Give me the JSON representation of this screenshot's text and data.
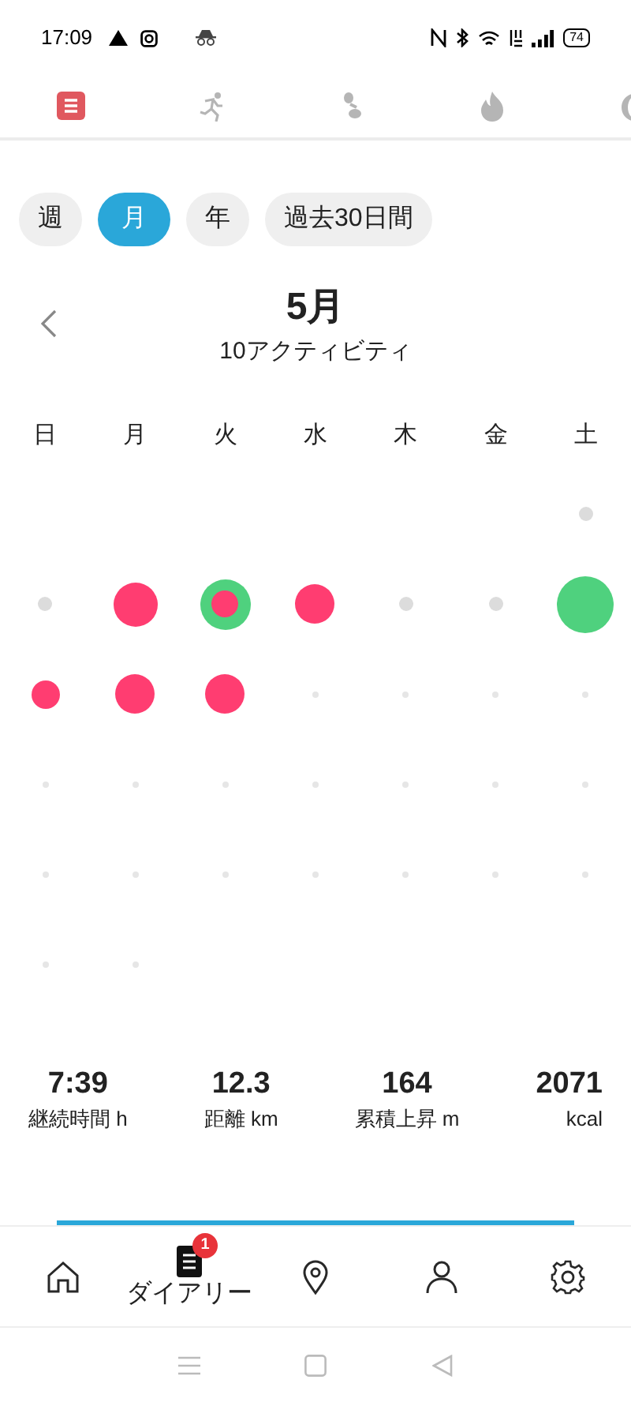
{
  "status_bar": {
    "time": "17:09",
    "battery": "74"
  },
  "tabs": [
    {
      "selected": true
    },
    {
      "selected": false
    },
    {
      "selected": false
    },
    {
      "selected": false
    },
    {
      "selected": false
    }
  ],
  "periods": [
    {
      "label": "週",
      "selected": false
    },
    {
      "label": "月",
      "selected": true
    },
    {
      "label": "年",
      "selected": false
    },
    {
      "label": "過去30日間",
      "selected": false
    }
  ],
  "month": {
    "title": "5月",
    "subtitle": "10アクティビティ"
  },
  "weekdays": [
    "日",
    "月",
    "火",
    "水",
    "木",
    "金",
    "土"
  ],
  "weeks": [
    [
      {
        "kind": "blank"
      },
      {
        "kind": "blank"
      },
      {
        "kind": "blank"
      },
      {
        "kind": "blank"
      },
      {
        "kind": "blank"
      },
      {
        "kind": "blank"
      },
      {
        "kind": "past"
      }
    ],
    [
      {
        "kind": "past"
      },
      {
        "kind": "activity",
        "rings": [
          {
            "color": "#ff3d71"
          }
        ]
      },
      {
        "kind": "activity",
        "rings": [
          {
            "color": "#4fd17e"
          },
          {
            "color": "#ff3d71"
          }
        ]
      },
      {
        "kind": "activity",
        "rings": [
          {
            "color": "#ff3d71"
          }
        ]
      },
      {
        "kind": "past"
      },
      {
        "kind": "past"
      },
      {
        "kind": "activity",
        "rings": [
          {
            "color": "#4fd17e"
          }
        ]
      }
    ],
    [
      {
        "kind": "activity",
        "rings": [
          {
            "color": "#ff3d71"
          }
        ]
      },
      {
        "kind": "activity",
        "rings": [
          {
            "color": "#ff3d71"
          }
        ]
      },
      {
        "kind": "activity",
        "rings": [
          {
            "color": "#ff3d71"
          }
        ]
      },
      {
        "kind": "future"
      },
      {
        "kind": "future"
      },
      {
        "kind": "future"
      },
      {
        "kind": "future"
      }
    ],
    [
      {
        "kind": "future"
      },
      {
        "kind": "future"
      },
      {
        "kind": "future"
      },
      {
        "kind": "future"
      },
      {
        "kind": "future"
      },
      {
        "kind": "future"
      },
      {
        "kind": "future"
      }
    ],
    [
      {
        "kind": "future"
      },
      {
        "kind": "future"
      },
      {
        "kind": "future"
      },
      {
        "kind": "future"
      },
      {
        "kind": "future"
      },
      {
        "kind": "future"
      },
      {
        "kind": "future"
      }
    ],
    [
      {
        "kind": "future"
      },
      {
        "kind": "future"
      },
      {
        "kind": "blank"
      },
      {
        "kind": "blank"
      },
      {
        "kind": "blank"
      },
      {
        "kind": "blank"
      },
      {
        "kind": "blank"
      }
    ]
  ],
  "stats": [
    {
      "value": "7:39",
      "label": "継続時間 h"
    },
    {
      "value": "12.3",
      "label": "距離 km"
    },
    {
      "value": "164",
      "label": "累積上昇 m"
    },
    {
      "value": "2071",
      "label": "kcal"
    }
  ],
  "bottom_nav": [
    {
      "selected": false
    },
    {
      "label": "ダイアリー",
      "badge": "1",
      "selected": true
    },
    {
      "selected": false
    },
    {
      "selected": false
    },
    {
      "selected": false
    }
  ]
}
